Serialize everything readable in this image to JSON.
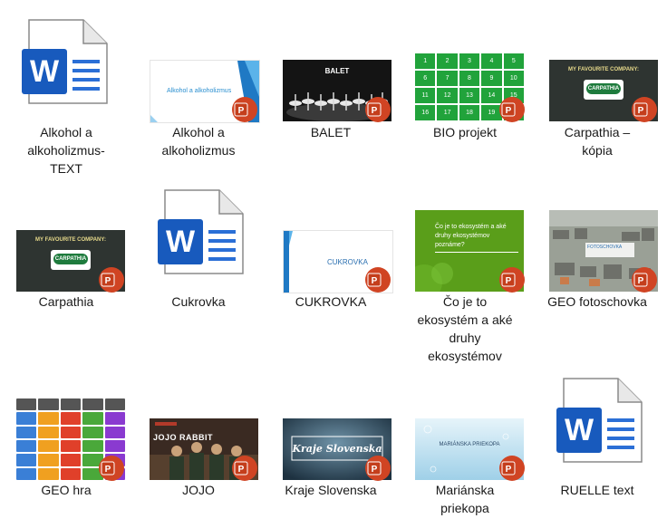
{
  "files": [
    {
      "name": "Alkohol a alkoholizmus-TEXT",
      "type": "word",
      "label_lines": [
        "Alkohol a",
        "alkoholizmus-",
        "TEXT"
      ]
    },
    {
      "name": "Alkohol a alkoholizmus",
      "type": "powerpoint",
      "label_lines": [
        "Alkohol a",
        "alkoholizmus"
      ],
      "slide_text": "Alkohol a alkoholizmus"
    },
    {
      "name": "BALET",
      "type": "powerpoint",
      "label_lines": [
        "BALET"
      ],
      "slide_text": "BALET"
    },
    {
      "name": "BIO projekt",
      "type": "powerpoint",
      "label_lines": [
        "BIO projekt"
      ]
    },
    {
      "name": "Carpathia – kópia",
      "type": "powerpoint",
      "label_lines": [
        "Carpathia –",
        "kópia"
      ],
      "slide_text": "MY FAVOURITE COMPANY:"
    },
    {
      "name": "Carpathia",
      "type": "powerpoint",
      "label_lines": [
        "Carpathia"
      ],
      "slide_text": "MY FAVOURITE COMPANY:"
    },
    {
      "name": "Cukrovka",
      "type": "word",
      "label_lines": [
        "Cukrovka"
      ]
    },
    {
      "name": "CUKROVKA",
      "type": "powerpoint",
      "label_lines": [
        "CUKROVKA"
      ],
      "slide_text": "CUKROVKA"
    },
    {
      "name": "Čo je to ekosystém a aké druhy ekosystémov",
      "type": "powerpoint",
      "label_lines": [
        "Čo je to",
        "ekosystém a aké",
        "druhy",
        "ekosystémov"
      ],
      "slide_text": "Čo je to ekosystém a aké druhy ekosystémov poznáme?"
    },
    {
      "name": "GEO fotoschovka",
      "type": "powerpoint",
      "label_lines": [
        "GEO fotoschovka"
      ],
      "slide_text": "FOTOSCHOVKA"
    },
    {
      "name": "GEO hra",
      "type": "powerpoint",
      "label_lines": [
        "GEO hra"
      ]
    },
    {
      "name": "JOJO",
      "type": "powerpoint",
      "label_lines": [
        "JOJO"
      ],
      "slide_text": "JOJO RABBIT"
    },
    {
      "name": "Kraje Slovenska",
      "type": "powerpoint",
      "label_lines": [
        "Kraje Slovenska"
      ],
      "slide_text": "Kraje Slovenska"
    },
    {
      "name": "Mariánska priekopa",
      "type": "powerpoint",
      "label_lines": [
        "Mariánska",
        "priekopa"
      ],
      "slide_text": "MARIÁNSKA PRIEKOPA"
    },
    {
      "name": "RUELLE text",
      "type": "word",
      "label_lines": [
        "RUELLE text"
      ]
    }
  ],
  "bio_grid_numbers": [
    "1",
    "2",
    "3",
    "4",
    "5",
    "6",
    "7",
    "8",
    "9",
    "10",
    "11",
    "12",
    "13",
    "14",
    "15",
    "16",
    "17",
    "18",
    "19",
    "20"
  ],
  "carpathia_logo_text": "CARPATHIA",
  "colors": {
    "word_blue": "#185abd",
    "ppt_orange": "#d04423",
    "bio_green": "#21a33b",
    "carpathia_bg": "#2e3431",
    "eco_green": "#5a9e1a"
  }
}
